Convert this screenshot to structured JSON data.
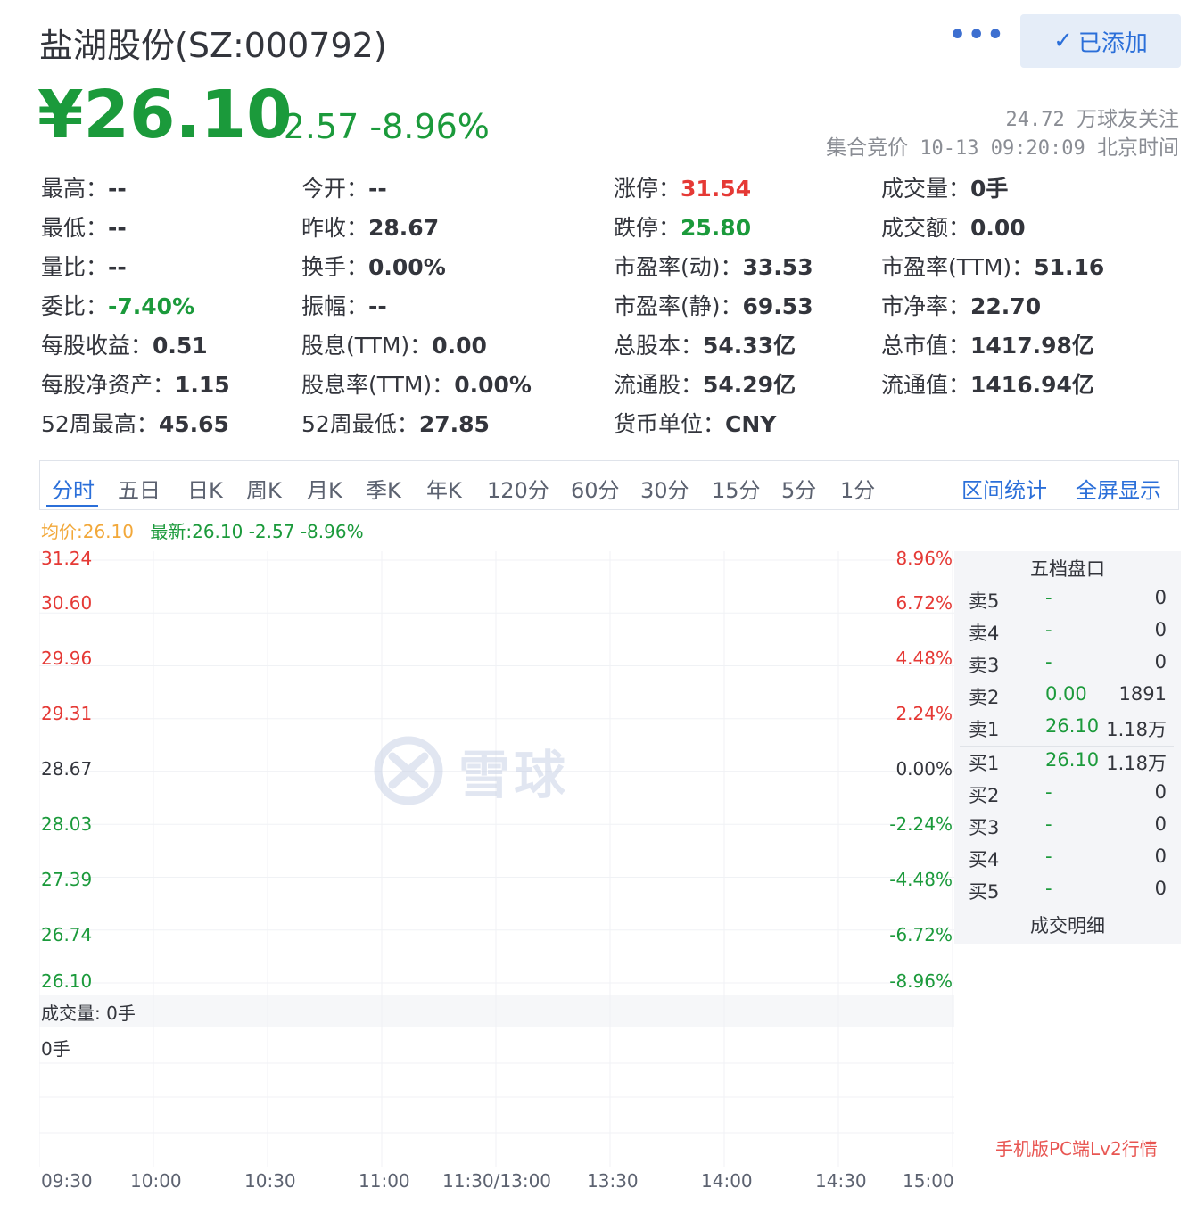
{
  "header": {
    "title": "盐湖股份(SZ:000792)",
    "more": "•••",
    "added_label": "已添加",
    "check": "✓"
  },
  "price": {
    "current": "¥26.10",
    "change": "-2.57",
    "change_pct": "-8.96%",
    "followers_num": "24.72",
    "followers_text": "万球友关注",
    "status_text": "集合竞价",
    "status_time": "10-13 09:20:09",
    "timezone": "北京时间"
  },
  "quotes": [
    [
      {
        "l": "最高：",
        "v": "--"
      },
      {
        "l": "今开：",
        "v": "--"
      },
      {
        "l": "涨停：",
        "v": "31.54",
        "c": "red"
      },
      {
        "l": "成交量：",
        "v": "0手"
      }
    ],
    [
      {
        "l": "最低：",
        "v": "--"
      },
      {
        "l": "昨收：",
        "v": "28.67"
      },
      {
        "l": "跌停：",
        "v": "25.80",
        "c": "green"
      },
      {
        "l": "成交额：",
        "v": "0.00"
      }
    ],
    [
      {
        "l": "量比：",
        "v": "--"
      },
      {
        "l": "换手：",
        "v": "0.00%"
      },
      {
        "l": "市盈率(动)：",
        "v": "33.53"
      },
      {
        "l": "市盈率(TTM)：",
        "v": "51.16"
      }
    ],
    [
      {
        "l": "委比：",
        "v": "-7.40%",
        "c": "green"
      },
      {
        "l": "振幅：",
        "v": "--"
      },
      {
        "l": "市盈率(静)：",
        "v": "69.53"
      },
      {
        "l": "市净率：",
        "v": "22.70"
      }
    ],
    [
      {
        "l": "每股收益：",
        "v": "0.51"
      },
      {
        "l": "股息(TTM)：",
        "v": "0.00"
      },
      {
        "l": "总股本：",
        "v": "54.33亿"
      },
      {
        "l": "总市值：",
        "v": "1417.98亿"
      }
    ],
    [
      {
        "l": "每股净资产：",
        "v": "1.15"
      },
      {
        "l": "股息率(TTM)：",
        "v": "0.00%"
      },
      {
        "l": "流通股：",
        "v": "54.29亿"
      },
      {
        "l": "流通值：",
        "v": "1416.94亿"
      }
    ],
    [
      {
        "l": "52周最高：",
        "v": "45.65"
      },
      {
        "l": "52周最低：",
        "v": "27.85"
      },
      {
        "l": "货币单位：",
        "v": "CNY"
      }
    ]
  ],
  "tabs": [
    "分时",
    "五日",
    "日K",
    "周K",
    "月K",
    "季K",
    "年K",
    "120分",
    "60分",
    "30分",
    "15分",
    "5分",
    "1分"
  ],
  "right_links": [
    "区间统计",
    "全屏显示"
  ],
  "legend": {
    "avg": "均价:26.10",
    "latest": "最新:26.10 -2.57 -8.96%"
  },
  "chart_data": {
    "type": "line",
    "y_left": [
      "31.24",
      "30.60",
      "29.96",
      "29.31",
      "28.67",
      "28.03",
      "27.39",
      "26.74",
      "26.10"
    ],
    "y_right": [
      "8.96%",
      "6.72%",
      "4.48%",
      "2.24%",
      "0.00%",
      "-2.24%",
      "-4.48%",
      "-6.72%",
      "-8.96%"
    ],
    "x": [
      "09:30",
      "10:00",
      "10:30",
      "11:00",
      "11:30/13:00",
      "13:30",
      "14:00",
      "14:30",
      "15:00"
    ],
    "series": [],
    "volume_label": "成交量: 0手",
    "volume_axis": "0手",
    "grid": true
  },
  "orderbook": {
    "title": "五档盘口",
    "asks": [
      {
        "side": "卖5",
        "price": "-",
        "vol": "0"
      },
      {
        "side": "卖4",
        "price": "-",
        "vol": "0"
      },
      {
        "side": "卖3",
        "price": "-",
        "vol": "0"
      },
      {
        "side": "卖2",
        "price": "0.00",
        "vol": "1891"
      },
      {
        "side": "卖1",
        "price": "26.10",
        "vol": "1.18万"
      }
    ],
    "bids": [
      {
        "side": "买1",
        "price": "26.10",
        "vol": "1.18万"
      },
      {
        "side": "买2",
        "price": "-",
        "vol": "0"
      },
      {
        "side": "买3",
        "price": "-",
        "vol": "0"
      },
      {
        "side": "买4",
        "price": "-",
        "vol": "0"
      },
      {
        "side": "买5",
        "price": "-",
        "vol": "0"
      }
    ],
    "deal_title": "成交明细"
  },
  "watermark": "雪球",
  "promo": "手机版PC端Lv2行情",
  "colors": {
    "up": "#e53935",
    "down": "#1b9a3b",
    "accent": "#2b6fd9",
    "avg": "#f2a83a"
  }
}
